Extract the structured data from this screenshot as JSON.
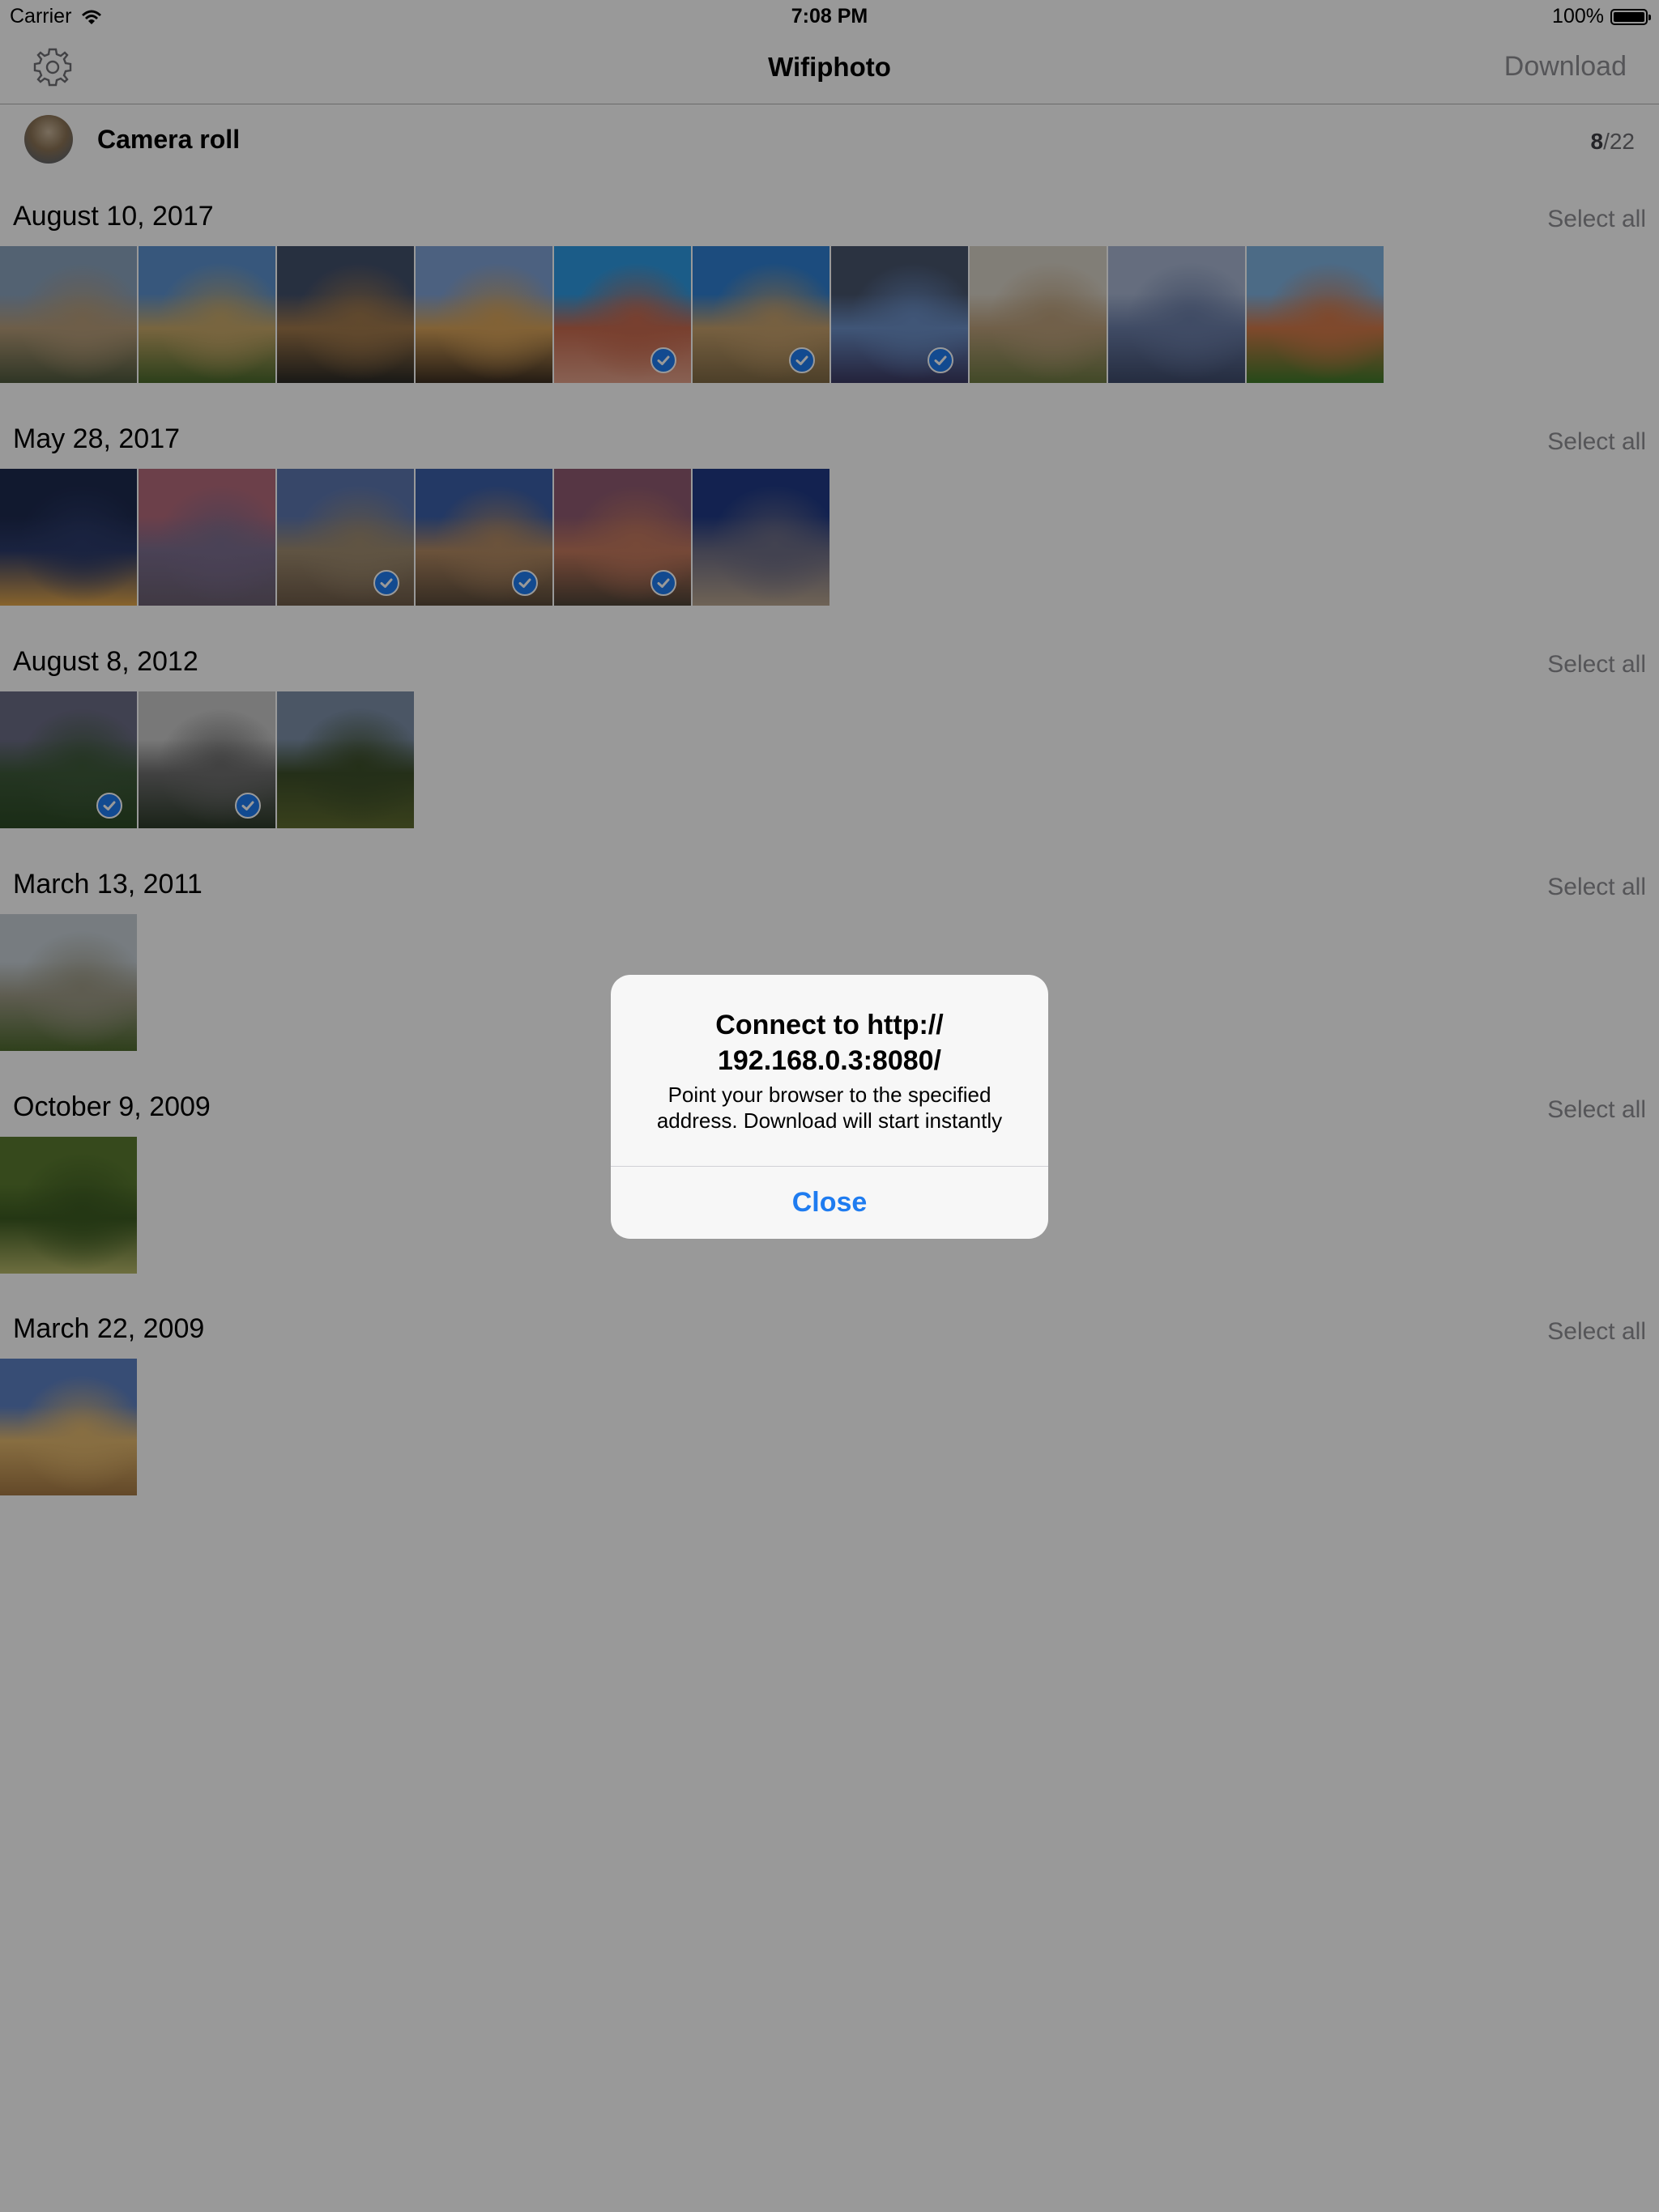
{
  "status_bar": {
    "carrier": "Carrier",
    "time": "7:08 PM",
    "battery": "100%"
  },
  "nav": {
    "title": "Wifiphoto",
    "download_label": "Download",
    "settings_icon": "gear-icon"
  },
  "album": {
    "name": "Camera roll",
    "selected_count": "8",
    "total_count": "/22"
  },
  "sections": [
    {
      "date": "August 10, 2017",
      "select_all": "Select all",
      "photos": [
        {
          "colors": [
            "#8aa3bf",
            "#b79d7a",
            "#4f5a3e"
          ],
          "checked": false
        },
        {
          "colors": [
            "#5d92cf",
            "#c9a96a",
            "#4a6a2c"
          ],
          "checked": false
        },
        {
          "colors": [
            "#42506c",
            "#a27a4c",
            "#2b2a26"
          ],
          "checked": false
        },
        {
          "colors": [
            "#7fa2d6",
            "#d9a35a",
            "#3d2f22"
          ],
          "checked": false
        },
        {
          "colors": [
            "#2e9ae3",
            "#c96b4f",
            "#e3a18a"
          ],
          "checked": true
        },
        {
          "colors": [
            "#2f7fd2",
            "#c6a06c",
            "#7f6a45"
          ],
          "checked": true
        },
        {
          "colors": [
            "#48556d",
            "#6b8fc7",
            "#3c3a63"
          ],
          "checked": true
        },
        {
          "colors": [
            "#d8d2c6",
            "#bca07b",
            "#6e7a43"
          ],
          "checked": false
        },
        {
          "colors": [
            "#a8b6d2",
            "#6b7ea8",
            "#3e4b6b"
          ],
          "checked": false
        },
        {
          "colors": [
            "#7fb2e0",
            "#d47a4a",
            "#3f7a2a"
          ],
          "checked": false
        }
      ]
    },
    {
      "date": "May 28, 2017",
      "select_all": "Select all",
      "photos": [
        {
          "colors": [
            "#1d2a4f",
            "#2c3b6b",
            "#e3a64a"
          ],
          "checked": false
        },
        {
          "colors": [
            "#b46b7c",
            "#7c6e8f",
            "#6b6071"
          ],
          "checked": false
        },
        {
          "colors": [
            "#5d77b0",
            "#a08c70",
            "#6f5c49"
          ],
          "checked": true
        },
        {
          "colors": [
            "#3b5fa8",
            "#b38a63",
            "#5a4a3a"
          ],
          "checked": true
        },
        {
          "colors": [
            "#8f5b72",
            "#c57a5e",
            "#4f4438"
          ],
          "checked": true
        },
        {
          "colors": [
            "#203a86",
            "#6e6e86",
            "#b9a58f"
          ],
          "checked": false
        }
      ]
    },
    {
      "date": "August 8, 2012",
      "select_all": "Select all",
      "photos": [
        {
          "colors": [
            "#6c6d86",
            "#3e5a3a",
            "#2c4a25"
          ],
          "checked": true
        },
        {
          "colors": [
            "#c9c9c9",
            "#6e6e6e",
            "#2d3b2a"
          ],
          "checked": true
        },
        {
          "colors": [
            "#7d8fa8",
            "#3d4f2a",
            "#5f6b2f"
          ],
          "checked": false
        }
      ]
    },
    {
      "date": "March 13, 2011",
      "select_all": "Select all",
      "photos": [
        {
          "colors": [
            "#c6cfd6",
            "#9d9a86",
            "#4f6b2f"
          ],
          "checked": false
        }
      ]
    },
    {
      "date": "October 9, 2009",
      "select_all": "Select all",
      "photos": [
        {
          "colors": [
            "#5a7a2f",
            "#3d5c22",
            "#b7b86a"
          ],
          "checked": false
        }
      ]
    },
    {
      "date": "March 22, 2009",
      "select_all": "Select all",
      "photos": [
        {
          "colors": [
            "#5c80c4",
            "#e3b86e",
            "#a67a45"
          ],
          "checked": false
        }
      ]
    }
  ],
  "alert": {
    "title": "Connect to http:// 192.168.0.3:8080/",
    "message": "Point your browser to the specified address. Download will start instantly",
    "button": "Close"
  },
  "colors": {
    "accent": "#1f7cf0",
    "secondary_text": "#8e8e93",
    "overlay": "rgba(0,0,0,0.40)"
  }
}
